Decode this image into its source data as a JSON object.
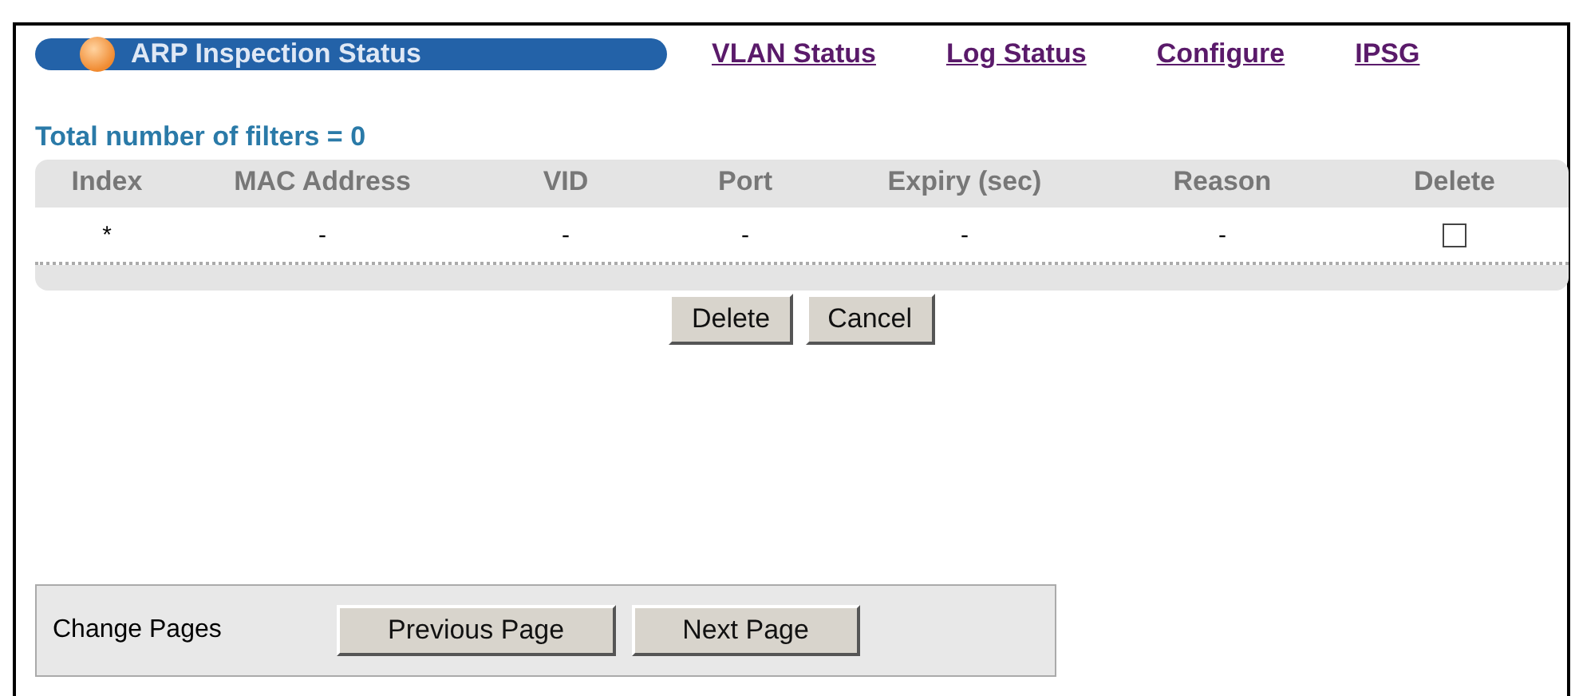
{
  "title_tab": {
    "label": "ARP Inspection Status"
  },
  "links": [
    "VLAN Status",
    "Log Status",
    "Configure",
    "IPSG"
  ],
  "summary": "Total number of filters = 0",
  "table": {
    "columns": [
      "Index",
      "MAC Address",
      "VID",
      "Port",
      "Expiry (sec)",
      "Reason",
      "Delete"
    ],
    "rows": [
      {
        "cells": [
          "*",
          "-",
          "-",
          "-",
          "-",
          "-"
        ],
        "checked": false
      }
    ]
  },
  "actions": [
    "Delete",
    "Cancel"
  ],
  "pager": {
    "label": "Change Pages",
    "buttons": [
      "Previous Page",
      "Next Page"
    ]
  }
}
